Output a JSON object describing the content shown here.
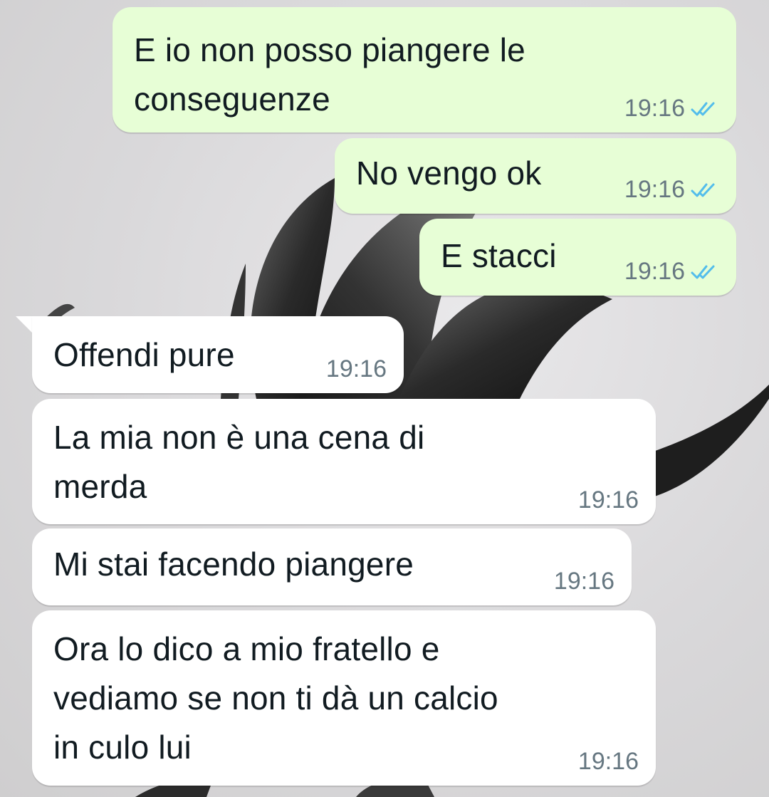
{
  "chat": {
    "messages": [
      {
        "direction": "outgoing",
        "lines": [
          "E io non posso piangere le",
          "conseguenze"
        ],
        "time": "19:16",
        "status": "read",
        "status_icon": "double-check-read-icon"
      },
      {
        "direction": "outgoing",
        "lines": [
          "No vengo ok"
        ],
        "time": "19:16",
        "status": "read",
        "status_icon": "double-check-read-icon"
      },
      {
        "direction": "outgoing",
        "lines": [
          "E stacci"
        ],
        "time": "19:16",
        "status": "read",
        "status_icon": "double-check-read-icon"
      },
      {
        "direction": "incoming",
        "lines": [
          "Offendi pure"
        ],
        "time": "19:16"
      },
      {
        "direction": "incoming",
        "lines": [
          "La mia non è una cena di",
          "merda"
        ],
        "time": "19:16"
      },
      {
        "direction": "incoming",
        "lines": [
          "Mi stai facendo piangere"
        ],
        "time": "19:16"
      },
      {
        "direction": "incoming",
        "lines": [
          "Ora lo dico a mio fratello e",
          "vediamo se non ti dà un calcio",
          "in culo lui"
        ],
        "time": "19:16"
      }
    ]
  },
  "colors": {
    "outgoing_bubble": "#e7fed6",
    "incoming_bubble": "#ffffff",
    "read_tick": "#53bdeb",
    "timestamp": "#667781",
    "message_text": "#111b21"
  }
}
